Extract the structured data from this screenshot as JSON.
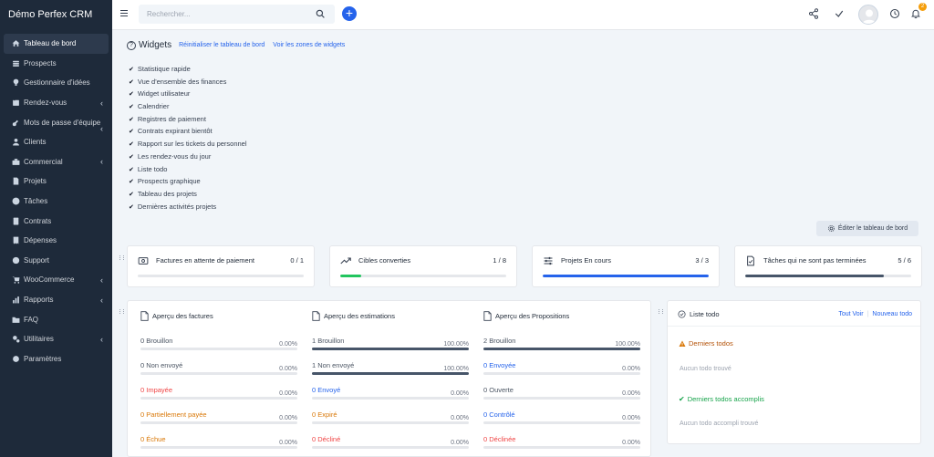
{
  "app": {
    "brand": "Démo Perfex CRM"
  },
  "sidebar": {
    "items": [
      {
        "label": "Tableau de bord",
        "icon": "home-icon",
        "active": true,
        "chevron": false
      },
      {
        "label": "Prospects",
        "icon": "prospects-icon",
        "active": false,
        "chevron": false
      },
      {
        "label": "Gestionnaire d'idées",
        "icon": "lightbulb-icon",
        "active": false,
        "chevron": false
      },
      {
        "label": "Rendez-vous",
        "icon": "calendar-icon",
        "active": false,
        "chevron": true
      },
      {
        "label": "Mots de passe d'équipe",
        "icon": "key-icon",
        "active": false,
        "chevron": true
      },
      {
        "label": "Clients",
        "icon": "user-icon",
        "active": false,
        "chevron": false
      },
      {
        "label": "Commercial",
        "icon": "briefcase-icon",
        "active": false,
        "chevron": true
      },
      {
        "label": "Projets",
        "icon": "file-icon",
        "active": false,
        "chevron": false
      },
      {
        "label": "Tâches",
        "icon": "check-circle-icon",
        "active": false,
        "chevron": false
      },
      {
        "label": "Contrats",
        "icon": "document-icon",
        "active": false,
        "chevron": false
      },
      {
        "label": "Dépenses",
        "icon": "receipt-icon",
        "active": false,
        "chevron": false
      },
      {
        "label": "Support",
        "icon": "support-icon",
        "active": false,
        "chevron": false
      },
      {
        "label": "WooCommerce",
        "icon": "cart-icon",
        "active": false,
        "chevron": true
      },
      {
        "label": "Rapports",
        "icon": "chart-icon",
        "active": false,
        "chevron": true
      },
      {
        "label": "FAQ",
        "icon": "folder-icon",
        "active": false,
        "chevron": false
      },
      {
        "label": "Utilitaires",
        "icon": "cogs-icon",
        "active": false,
        "chevron": true
      },
      {
        "label": "Paramètres",
        "icon": "gear-icon",
        "active": false,
        "chevron": false
      }
    ]
  },
  "header": {
    "search_placeholder": "Rechercher...",
    "add_label": "+",
    "notification_count": "2"
  },
  "widgets": {
    "title": "Widgets",
    "reset_link": "Réinitialiser le tableau de bord",
    "zones_link": "Voir les zones de widgets",
    "items": [
      "Statistique rapide",
      "Vue d'ensemble des finances",
      "Widget utilisateur",
      "Calendrier",
      "Registres de paiement",
      "Contrats expirant bientôt",
      "Rapport sur les tickets du personnel",
      "Les rendez-vous du jour",
      "Liste todo",
      "Prospects graphique",
      "Tableau des projets",
      "Dernières activités projets"
    ],
    "edit_button": "Éditer le tableau de bord"
  },
  "stats": [
    {
      "label": "Factures en attente de paiement",
      "value": "0 / 1",
      "fraction": 0,
      "color": "#2563eb",
      "icon": "invoice-icon"
    },
    {
      "label": "Cibles converties",
      "value": "1 / 8",
      "fraction": 0.125,
      "color": "#22c55e",
      "icon": "trend-icon"
    },
    {
      "label": "Projets En cours",
      "value": "3 / 3",
      "fraction": 1,
      "color": "#2563eb",
      "icon": "sliders-icon"
    },
    {
      "label": "Tâches qui ne sont pas terminées",
      "value": "5 / 6",
      "fraction": 0.8333,
      "color": "#475569",
      "icon": "task-file-icon"
    }
  ],
  "overview": {
    "columns": [
      {
        "title": "Aperçu des factures",
        "rows": [
          {
            "label": "0 Brouillon",
            "percent": "0.00%",
            "fraction": 0,
            "color": "#4b5563"
          },
          {
            "label": "0 Non envoyé",
            "percent": "0.00%",
            "fraction": 0,
            "color": "#4b5563"
          },
          {
            "label": "0 Impayée",
            "percent": "0.00%",
            "fraction": 0,
            "color": "#ef4444"
          },
          {
            "label": "0 Partiellement payée",
            "percent": "0.00%",
            "fraction": 0,
            "color": "#d97706"
          },
          {
            "label": "0 Échue",
            "percent": "0.00%",
            "fraction": 0,
            "color": "#d97706"
          }
        ]
      },
      {
        "title": "Aperçu des estimations",
        "rows": [
          {
            "label": "1 Brouillon",
            "percent": "100.00%",
            "fraction": 1,
            "color": "#4b5563"
          },
          {
            "label": "1 Non envoyé",
            "percent": "100.00%",
            "fraction": 1,
            "color": "#4b5563"
          },
          {
            "label": "0 Envoyé",
            "percent": "0.00%",
            "fraction": 0,
            "color": "#2563eb"
          },
          {
            "label": "0 Expiré",
            "percent": "0.00%",
            "fraction": 0,
            "color": "#d97706"
          },
          {
            "label": "0 Décliné",
            "percent": "0.00%",
            "fraction": 0,
            "color": "#ef4444"
          }
        ]
      },
      {
        "title": "Aperçu des Propositions",
        "rows": [
          {
            "label": "2 Brouillon",
            "percent": "100.00%",
            "fraction": 1,
            "color": "#4b5563"
          },
          {
            "label": "0 Envoyée",
            "percent": "0.00%",
            "fraction": 0,
            "color": "#2563eb"
          },
          {
            "label": "0 Ouverte",
            "percent": "0.00%",
            "fraction": 0,
            "color": "#4b5563"
          },
          {
            "label": "0 Contrôlé",
            "percent": "0.00%",
            "fraction": 0,
            "color": "#2563eb"
          },
          {
            "label": "0 Déclinée",
            "percent": "0.00%",
            "fraction": 0,
            "color": "#ef4444"
          }
        ]
      }
    ]
  },
  "todo": {
    "title": "Liste todo",
    "view_all": "Tout Voir",
    "new_todo": "Nouveau todo",
    "latest_title": "Derniers todos",
    "latest_empty": "Aucun todo trouvé",
    "done_title": "Derniers todos accomplis",
    "done_empty": "Aucun todo accompli trouvé"
  }
}
